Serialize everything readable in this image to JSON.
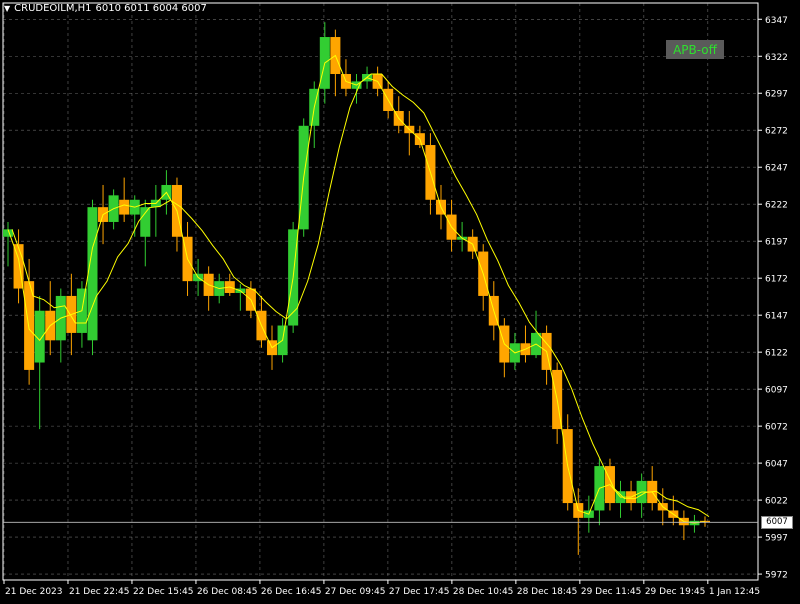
{
  "header": {
    "symbol": "CRUDEOILM,H1",
    "ohlc": "6010 6011 6004 6007"
  },
  "badge": {
    "label": "APB-off",
    "text_color": "#2ee02e",
    "bg_color": "#5a5a5a"
  },
  "colors": {
    "background": "#000000",
    "grid": "#c0c0c0",
    "bull": "#32cd32",
    "bear": "#ffa500",
    "ma": "#ffff00",
    "axis_text": "#ffffff"
  },
  "chart_data": {
    "type": "candlestick",
    "title": "",
    "current_price": 6007,
    "current_price_label": "6007",
    "y_ticks": [
      6347,
      6322,
      6297,
      6272,
      6247,
      6222,
      6197,
      6172,
      6147,
      6122,
      6097,
      6072,
      6047,
      6022,
      5997,
      5972
    ],
    "x_ticks": [
      "21 Dec 2023",
      "21 Dec 22:45",
      "22 Dec 15:45",
      "26 Dec 08:45",
      "26 Dec 16:45",
      "27 Dec 09:45",
      "27 Dec 17:45",
      "28 Dec 10:45",
      "28 Dec 18:45",
      "29 Dec 11:45",
      "29 Dec 19:45",
      "1 Jan 12:45"
    ],
    "ylim": [
      5968,
      6358
    ],
    "grid": true,
    "candles": [
      {
        "o": 6200,
        "h": 6210,
        "l": 6180,
        "c": 6205
      },
      {
        "o": 6195,
        "h": 6205,
        "l": 6155,
        "c": 6165
      },
      {
        "o": 6170,
        "h": 6185,
        "l": 6100,
        "c": 6110
      },
      {
        "o": 6115,
        "h": 6160,
        "l": 6070,
        "c": 6150
      },
      {
        "o": 6150,
        "h": 6170,
        "l": 6120,
        "c": 6130
      },
      {
        "o": 6130,
        "h": 6165,
        "l": 6115,
        "c": 6160
      },
      {
        "o": 6160,
        "h": 6175,
        "l": 6120,
        "c": 6135
      },
      {
        "o": 6135,
        "h": 6170,
        "l": 6125,
        "c": 6165
      },
      {
        "o": 6130,
        "h": 6225,
        "l": 6120,
        "c": 6220
      },
      {
        "o": 6220,
        "h": 6235,
        "l": 6195,
        "c": 6210
      },
      {
        "o": 6210,
        "h": 6232,
        "l": 6205,
        "c": 6228
      },
      {
        "o": 6225,
        "h": 6240,
        "l": 6210,
        "c": 6215
      },
      {
        "o": 6215,
        "h": 6228,
        "l": 6200,
        "c": 6225
      },
      {
        "o": 6200,
        "h": 6225,
        "l": 6180,
        "c": 6220
      },
      {
        "o": 6220,
        "h": 6235,
        "l": 6200,
        "c": 6225
      },
      {
        "o": 6225,
        "h": 6245,
        "l": 6215,
        "c": 6235
      },
      {
        "o": 6235,
        "h": 6240,
        "l": 6190,
        "c": 6200
      },
      {
        "o": 6200,
        "h": 6210,
        "l": 6160,
        "c": 6170
      },
      {
        "o": 6170,
        "h": 6185,
        "l": 6160,
        "c": 6175
      },
      {
        "o": 6175,
        "h": 6180,
        "l": 6150,
        "c": 6160
      },
      {
        "o": 6160,
        "h": 6175,
        "l": 6155,
        "c": 6170
      },
      {
        "o": 6170,
        "h": 6175,
        "l": 6160,
        "c": 6162
      },
      {
        "o": 6162,
        "h": 6168,
        "l": 6150,
        "c": 6165
      },
      {
        "o": 6165,
        "h": 6170,
        "l": 6145,
        "c": 6150
      },
      {
        "o": 6150,
        "h": 6160,
        "l": 6125,
        "c": 6130
      },
      {
        "o": 6130,
        "h": 6140,
        "l": 6110,
        "c": 6120
      },
      {
        "o": 6120,
        "h": 6145,
        "l": 6115,
        "c": 6140
      },
      {
        "o": 6140,
        "h": 6210,
        "l": 6135,
        "c": 6205
      },
      {
        "o": 6205,
        "h": 6280,
        "l": 6200,
        "c": 6275
      },
      {
        "o": 6275,
        "h": 6305,
        "l": 6260,
        "c": 6300
      },
      {
        "o": 6300,
        "h": 6345,
        "l": 6290,
        "c": 6335
      },
      {
        "o": 6335,
        "h": 6340,
        "l": 6295,
        "c": 6310
      },
      {
        "o": 6310,
        "h": 6320,
        "l": 6295,
        "c": 6300
      },
      {
        "o": 6300,
        "h": 6310,
        "l": 6290,
        "c": 6305
      },
      {
        "o": 6305,
        "h": 6315,
        "l": 6300,
        "c": 6310
      },
      {
        "o": 6310,
        "h": 6315,
        "l": 6295,
        "c": 6300
      },
      {
        "o": 6300,
        "h": 6305,
        "l": 6280,
        "c": 6285
      },
      {
        "o": 6285,
        "h": 6295,
        "l": 6270,
        "c": 6275
      },
      {
        "o": 6275,
        "h": 6285,
        "l": 6255,
        "c": 6270
      },
      {
        "o": 6270,
        "h": 6275,
        "l": 6260,
        "c": 6262
      },
      {
        "o": 6262,
        "h": 6270,
        "l": 6215,
        "c": 6225
      },
      {
        "o": 6225,
        "h": 6235,
        "l": 6205,
        "c": 6215
      },
      {
        "o": 6215,
        "h": 6225,
        "l": 6190,
        "c": 6198
      },
      {
        "o": 6198,
        "h": 6210,
        "l": 6190,
        "c": 6200
      },
      {
        "o": 6200,
        "h": 6205,
        "l": 6185,
        "c": 6190
      },
      {
        "o": 6190,
        "h": 6195,
        "l": 6150,
        "c": 6160
      },
      {
        "o": 6160,
        "h": 6170,
        "l": 6130,
        "c": 6140
      },
      {
        "o": 6140,
        "h": 6145,
        "l": 6105,
        "c": 6115
      },
      {
        "o": 6115,
        "h": 6135,
        "l": 6110,
        "c": 6128
      },
      {
        "o": 6128,
        "h": 6140,
        "l": 6115,
        "c": 6120
      },
      {
        "o": 6120,
        "h": 6150,
        "l": 6118,
        "c": 6135
      },
      {
        "o": 6135,
        "h": 6140,
        "l": 6100,
        "c": 6110
      },
      {
        "o": 6110,
        "h": 6115,
        "l": 6060,
        "c": 6070
      },
      {
        "o": 6070,
        "h": 6080,
        "l": 6015,
        "c": 6020
      },
      {
        "o": 6020,
        "h": 6030,
        "l": 5985,
        "c": 6010
      },
      {
        "o": 6010,
        "h": 6025,
        "l": 6000,
        "c": 6015
      },
      {
        "o": 6015,
        "h": 6050,
        "l": 6005,
        "c": 6045
      },
      {
        "o": 6045,
        "h": 6050,
        "l": 6015,
        "c": 6020
      },
      {
        "o": 6020,
        "h": 6035,
        "l": 6010,
        "c": 6028
      },
      {
        "o": 6028,
        "h": 6035,
        "l": 6015,
        "c": 6020
      },
      {
        "o": 6020,
        "h": 6040,
        "l": 6010,
        "c": 6035
      },
      {
        "o": 6035,
        "h": 6045,
        "l": 6015,
        "c": 6020
      },
      {
        "o": 6020,
        "h": 6030,
        "l": 6005,
        "c": 6015
      },
      {
        "o": 6015,
        "h": 6025,
        "l": 6005,
        "c": 6010
      },
      {
        "o": 6010,
        "h": 6015,
        "l": 5995,
        "c": 6005
      },
      {
        "o": 6005,
        "h": 6012,
        "l": 6000,
        "c": 6008
      },
      {
        "o": 6008,
        "h": 6011,
        "l": 6004,
        "c": 6007
      }
    ]
  }
}
